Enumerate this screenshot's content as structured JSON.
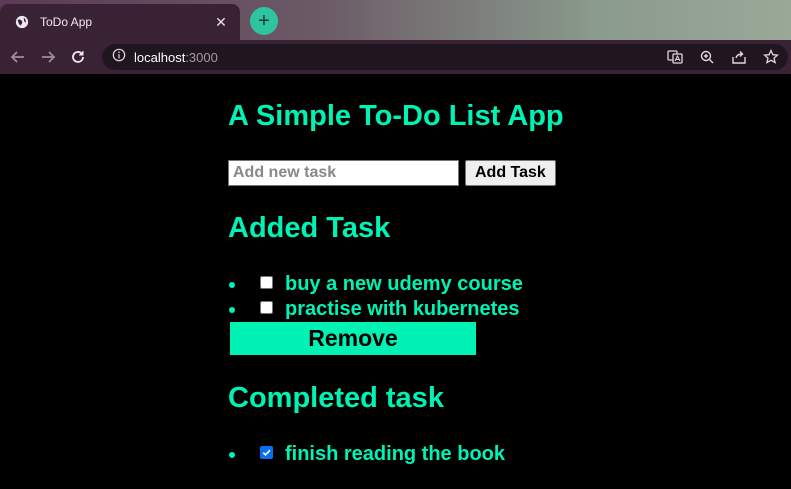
{
  "browser": {
    "tab_title": "ToDo App",
    "close_glyph": "✕",
    "new_tab_glyph": "+",
    "url_host": "localhost",
    "url_port": ":3000"
  },
  "app": {
    "title": "A Simple To-Do List App",
    "input_placeholder": "Add new task",
    "add_button": "Add Task",
    "added_section_title": "Added Task",
    "added_tasks": [
      {
        "label": "buy a new udemy course",
        "checked": false
      },
      {
        "label": "practise with kubernetes",
        "checked": false
      }
    ],
    "remove_button": "Remove",
    "completed_section_title": "Completed task",
    "completed_tasks": [
      {
        "label": "finish reading the book",
        "checked": true
      }
    ]
  },
  "colors": {
    "accent": "#00f2b5",
    "background": "#000000",
    "checkbox_checked": "#0a6ef0"
  }
}
